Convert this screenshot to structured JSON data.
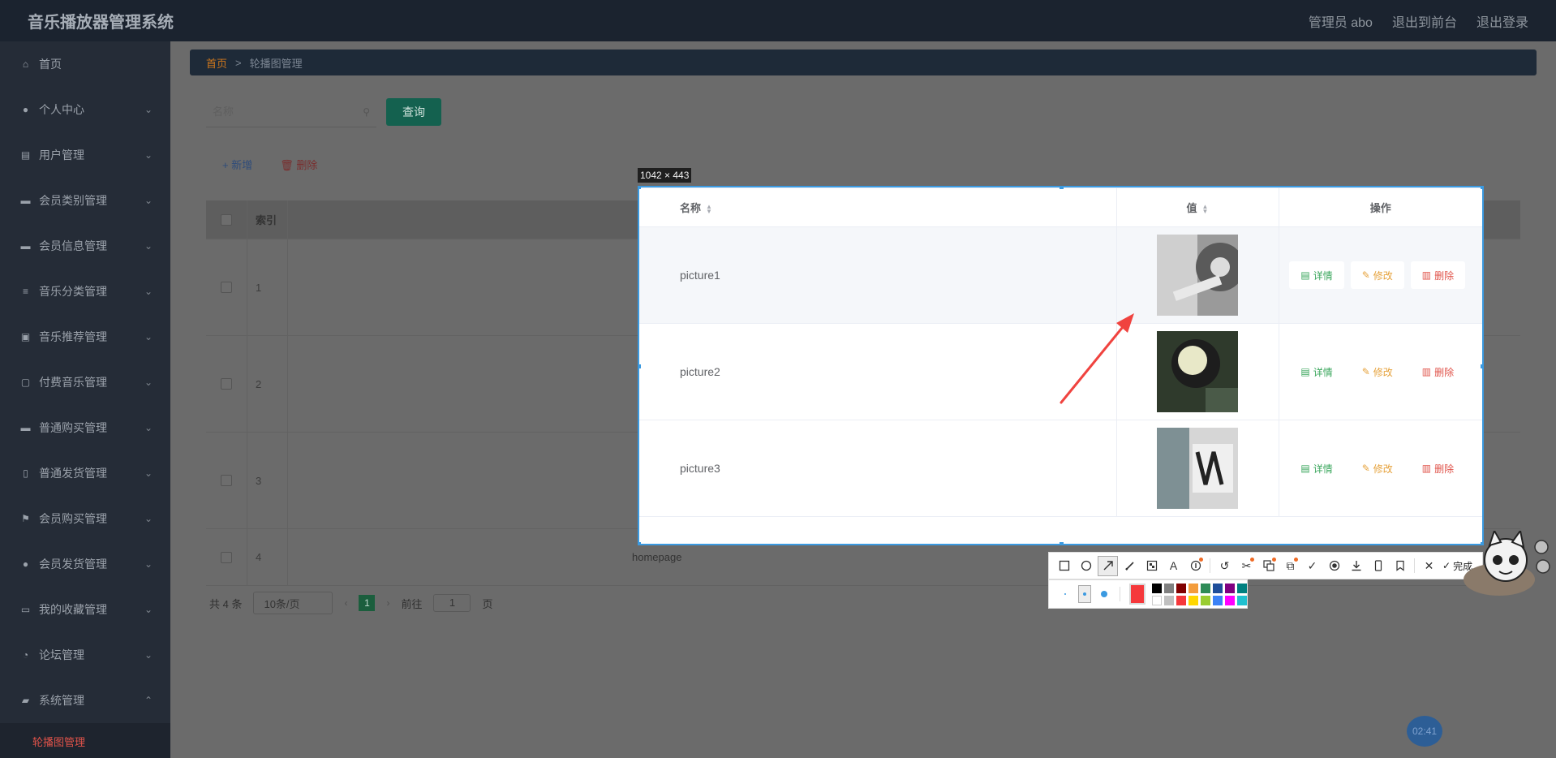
{
  "header": {
    "title": "音乐播放器管理系统",
    "user": "管理员 abo",
    "to_front": "退出到前台",
    "logout": "退出登录"
  },
  "sidebar": {
    "items": [
      {
        "label": "首页",
        "icon": "home-icon",
        "chevron": ""
      },
      {
        "label": "个人中心",
        "icon": "user-icon",
        "chevron": "⌄"
      },
      {
        "label": "用户管理",
        "icon": "table-icon",
        "chevron": "⌄"
      },
      {
        "label": "会员类别管理",
        "icon": "card-icon",
        "chevron": "⌄"
      },
      {
        "label": "会员信息管理",
        "icon": "card-icon",
        "chevron": "⌄"
      },
      {
        "label": "音乐分类管理",
        "icon": "list-icon",
        "chevron": "⌄"
      },
      {
        "label": "音乐推荐管理",
        "icon": "clipboard-icon",
        "chevron": "⌄"
      },
      {
        "label": "付费音乐管理",
        "icon": "chat-icon",
        "chevron": "⌄"
      },
      {
        "label": "普通购买管理",
        "icon": "card-icon",
        "chevron": "⌄"
      },
      {
        "label": "普通发货管理",
        "icon": "phone-icon",
        "chevron": "⌄"
      },
      {
        "label": "会员购买管理",
        "icon": "flag-icon",
        "chevron": "⌄"
      },
      {
        "label": "会员发货管理",
        "icon": "user-icon",
        "chevron": "⌄"
      },
      {
        "label": "我的收藏管理",
        "icon": "folder-icon",
        "chevron": "⌄"
      },
      {
        "label": "论坛管理",
        "icon": "compass-icon",
        "chevron": "⌄"
      },
      {
        "label": "系统管理",
        "icon": "ticket-icon",
        "chevron": "⌃"
      }
    ],
    "sub_item": "轮播图管理"
  },
  "breadcrumb": {
    "home": "首页",
    "separator": ">",
    "current": "轮播图管理"
  },
  "search": {
    "placeholder": "名称",
    "button": "查询"
  },
  "actions": {
    "add": "+ 新增",
    "delete": "删除"
  },
  "bg_table": {
    "header_index": "索引",
    "rows": [
      {
        "index": "1",
        "name": ""
      },
      {
        "index": "2",
        "name": ""
      },
      {
        "index": "3",
        "name": ""
      },
      {
        "index": "4",
        "name": "homepage"
      }
    ]
  },
  "pagination": {
    "total": "共 4 条",
    "page_size": "10条/页",
    "prev": "‹",
    "current": "1",
    "next": "›",
    "goto_prefix": "前往",
    "goto_value": "1",
    "goto_suffix": "页"
  },
  "capture": {
    "size_label": "1042 × 443",
    "columns": {
      "name": "名称",
      "value": "值",
      "operation": "操作"
    },
    "rows": [
      {
        "name": "picture1"
      },
      {
        "name": "picture2"
      },
      {
        "name": "picture3"
      }
    ],
    "op_labels": {
      "detail": "详情",
      "edit": "修改",
      "delete": "删除"
    }
  },
  "tools": {
    "done": "完成"
  },
  "colors": {
    "accent_green": "#14614f",
    "selection_blue": "#3b9ae1",
    "annotation_red": "#f5383b",
    "current_page": "#1b5e3d",
    "palette": [
      "#000000",
      "#808080",
      "#800000",
      "#f39c3b",
      "#2e8b57",
      "#1e4e9a",
      "#800080",
      "#008080",
      "#ffffff",
      "#c0c0c0",
      "#f5383b",
      "#ffd700",
      "#9acd32",
      "#3b82f6",
      "#ff00ff",
      "#20c0d0"
    ]
  },
  "clock": "02:41"
}
